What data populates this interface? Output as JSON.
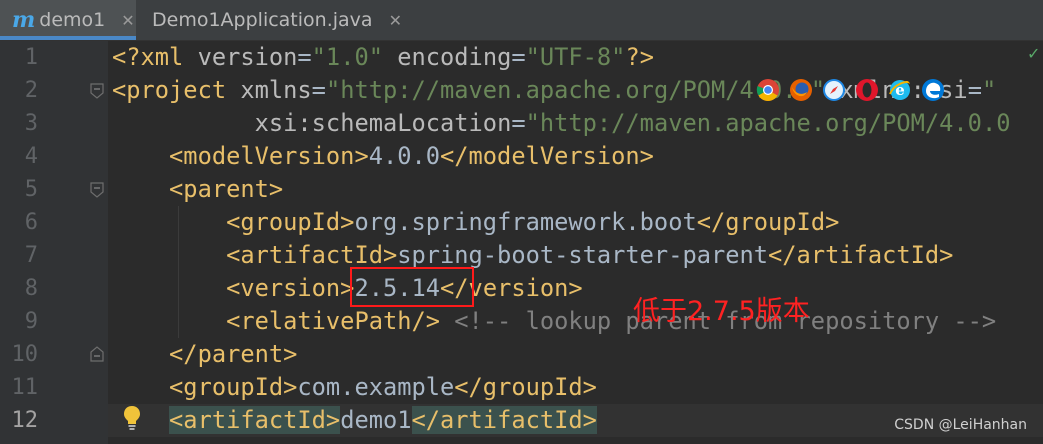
{
  "tabs": [
    {
      "label": "demo1",
      "icon": "maven-icon",
      "close": "✕",
      "active": true
    },
    {
      "label": "Demo1Application.java",
      "icon": "java-class-icon",
      "close": "✕",
      "active": false
    }
  ],
  "line_numbers": [
    "1",
    "2",
    "3",
    "4",
    "5",
    "6",
    "7",
    "8",
    "9",
    "10",
    "11",
    "12"
  ],
  "current_line": "12",
  "code": {
    "l1": {
      "pi_open": "<?xml ",
      "a1": "version",
      "eq1": "=",
      "v1": "\"1.0\"",
      "sp": " ",
      "a2": "encoding",
      "eq2": "=",
      "v2": "\"UTF-8\"",
      "pi_close": "?>"
    },
    "l2": {
      "open": "<project ",
      "a1": "xmlns",
      "eq1": "=",
      "v1": "\"http://maven.apache.org/POM/4.0.0\"",
      "sp": " ",
      "a2": "xmlns:xsi",
      "eq2": "=",
      "v2": "\""
    },
    "l3": {
      "indent": "          ",
      "a1": "xsi:schemaLocation",
      "eq1": "=",
      "v1": "\"http://maven.apache.org/POM/4.0.0"
    },
    "l4": {
      "indent": "    ",
      "open": "<modelVersion>",
      "text": "4.0.0",
      "close": "</modelVersion>"
    },
    "l5": {
      "indent": "    ",
      "open": "<parent>"
    },
    "l6": {
      "indent": "        ",
      "open": "<groupId>",
      "text": "org.springframework.boot",
      "close": "</groupId>"
    },
    "l7": {
      "indent": "        ",
      "open": "<artifactId>",
      "text": "spring-boot-starter-parent",
      "close": "</artifactId>"
    },
    "l8": {
      "indent": "        ",
      "open": "<version>",
      "text": "2.5.14",
      "close": "</version>"
    },
    "l9": {
      "indent": "        ",
      "tag": "<relativePath/>",
      "comment": " <!-- lookup parent from repository -->"
    },
    "l10": {
      "indent": "    ",
      "close": "</parent>"
    },
    "l11": {
      "indent": "    ",
      "open": "<groupId>",
      "text": "com.example",
      "close": "</groupId>"
    },
    "l12": {
      "indent": "    ",
      "open": "<artifactId>",
      "text": "demo1",
      "close": "</artifactId>"
    }
  },
  "annotation": "低于2.7.5版本",
  "watermark": "CSDN @LeiHanhan",
  "status_check": "✓",
  "browser_icons": [
    "chrome-icon",
    "firefox-icon",
    "safari-icon",
    "opera-icon",
    "ie-icon",
    "edge-icon"
  ],
  "colors": {
    "annotation": "#ff2222",
    "tag": "#e8bf6a",
    "string": "#6a8759",
    "attribute": "#bababa",
    "comment": "#808080",
    "text": "#a9b7c6",
    "background": "#2b2b2b"
  }
}
